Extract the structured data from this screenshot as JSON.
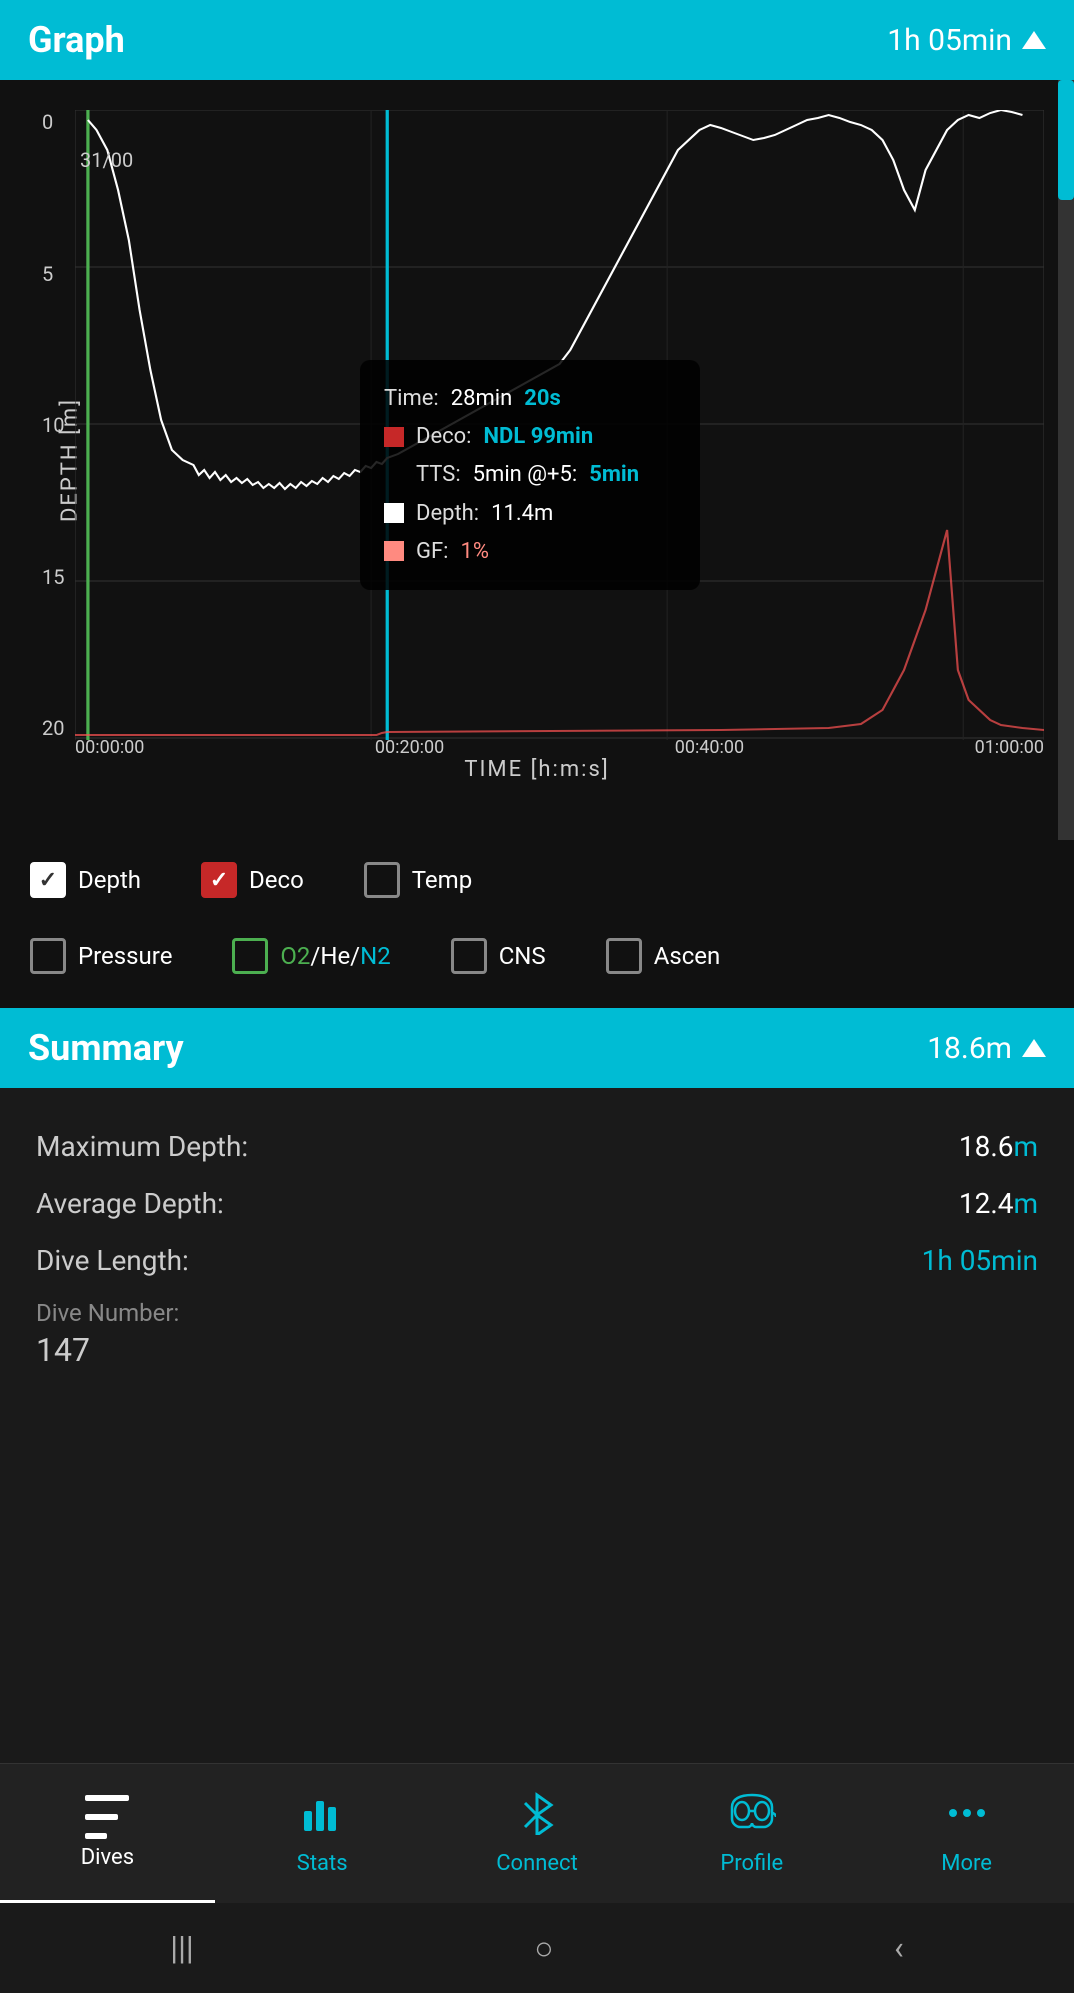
{
  "graph": {
    "title": "Graph",
    "duration": "1h 05min",
    "y_axis_label": "DEPTH [m]",
    "x_axis_label": "TIME [h:m:s]",
    "y_ticks": [
      "0",
      "5",
      "10",
      "15",
      "20"
    ],
    "x_ticks": [
      "00:00:00",
      "00:20:00",
      "00:40:00",
      "01:00:00"
    ],
    "grid_label": "31/00",
    "scrollbar": true,
    "tooltip": {
      "time_label": "Time:",
      "time_value": "28min",
      "time_seconds": "20s",
      "deco_label": "Deco:",
      "deco_value": "NDL 99min",
      "tts_label": "TTS:",
      "tts_value": "5min @+5:",
      "tts_value2": "5min",
      "depth_label": "Depth:",
      "depth_value": "11.4m",
      "gf_label": "GF:",
      "gf_value": "1%"
    }
  },
  "checkboxes": {
    "row1": [
      {
        "id": "depth",
        "label": "Depth",
        "checked": true,
        "type": "white"
      },
      {
        "id": "deco",
        "label": "Deco",
        "checked": true,
        "type": "red"
      },
      {
        "id": "temp",
        "label": "Temp",
        "checked": false,
        "type": "none"
      }
    ],
    "row2": [
      {
        "id": "pressure",
        "label": "Pressure",
        "checked": false,
        "type": "none"
      },
      {
        "id": "gas",
        "label": "O2/He/N2",
        "checked": false,
        "type": "green"
      },
      {
        "id": "cns",
        "label": "CNS",
        "checked": false,
        "type": "none"
      },
      {
        "id": "ascent",
        "label": "Ascen",
        "checked": false,
        "type": "none"
      }
    ]
  },
  "summary": {
    "title": "Summary",
    "depth_badge": "18.6m",
    "rows": [
      {
        "label": "Maximum Depth:",
        "value": "18.6",
        "unit": "m",
        "color": "cyan"
      },
      {
        "label": "Average Depth:",
        "value": "12.4",
        "unit": "m",
        "color": "cyan"
      },
      {
        "label": "Dive Length:",
        "value": "1h 05min",
        "unit": "",
        "color": "cyan"
      }
    ],
    "dive_number_label": "Dive Number:",
    "dive_number_value": "147"
  },
  "bottom_nav": {
    "items": [
      {
        "id": "dives",
        "label": "Dives",
        "active": true
      },
      {
        "id": "stats",
        "label": "Stats",
        "active": false
      },
      {
        "id": "connect",
        "label": "Connect",
        "active": false
      },
      {
        "id": "profile",
        "label": "Profile",
        "active": false
      },
      {
        "id": "more",
        "label": "More",
        "active": false
      }
    ]
  },
  "phone_bar": {
    "back": "‹",
    "home": "○",
    "recent": "|||"
  }
}
